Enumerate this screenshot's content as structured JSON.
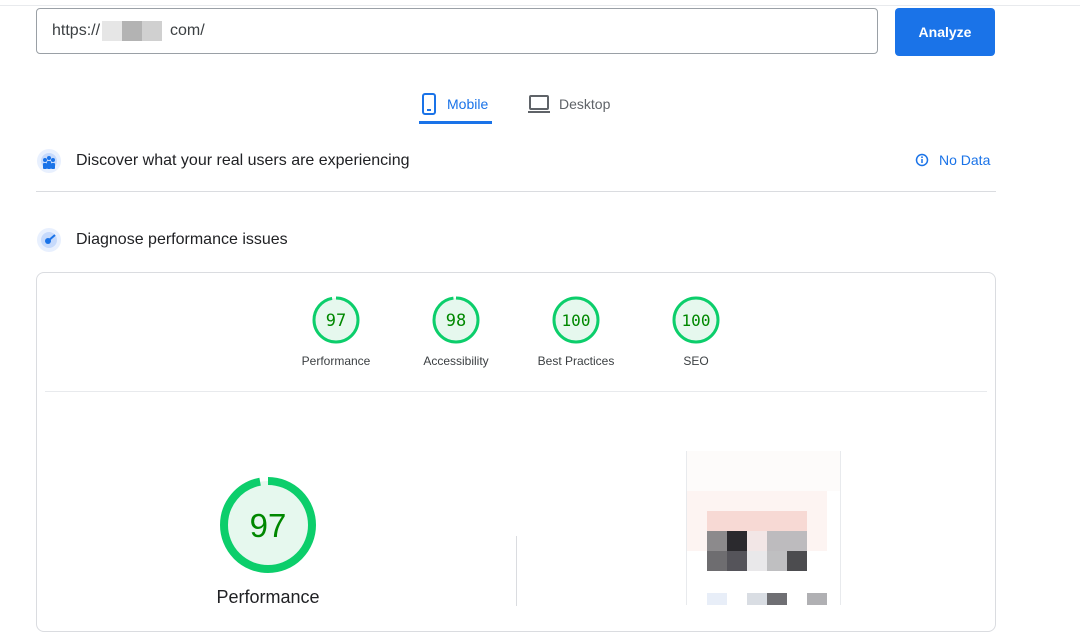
{
  "search": {
    "url_prefix": "https://",
    "url_suffix": "com/",
    "analyze_label": "Analyze"
  },
  "tabs": [
    {
      "label": "Mobile",
      "icon": "phone-icon",
      "active": true
    },
    {
      "label": "Desktop",
      "icon": "laptop-icon",
      "active": false
    }
  ],
  "field_data": {
    "title": "Discover what your real users are experiencing",
    "status": "No Data",
    "icon": "users-icon"
  },
  "lab_data": {
    "title": "Diagnose performance issues",
    "icon": "speedometer-icon"
  },
  "scores": [
    {
      "value": 97,
      "label": "Performance"
    },
    {
      "value": 98,
      "label": "Accessibility"
    },
    {
      "value": 100,
      "label": "Best Practices"
    },
    {
      "value": 100,
      "label": "SEO"
    }
  ],
  "main_score": {
    "value": 97,
    "label": "Performance"
  },
  "colors": {
    "accent": "#1a73e8",
    "pass": "#0cce6b",
    "pass_text": "#008800",
    "pass_fill": "#e6f8ee"
  }
}
